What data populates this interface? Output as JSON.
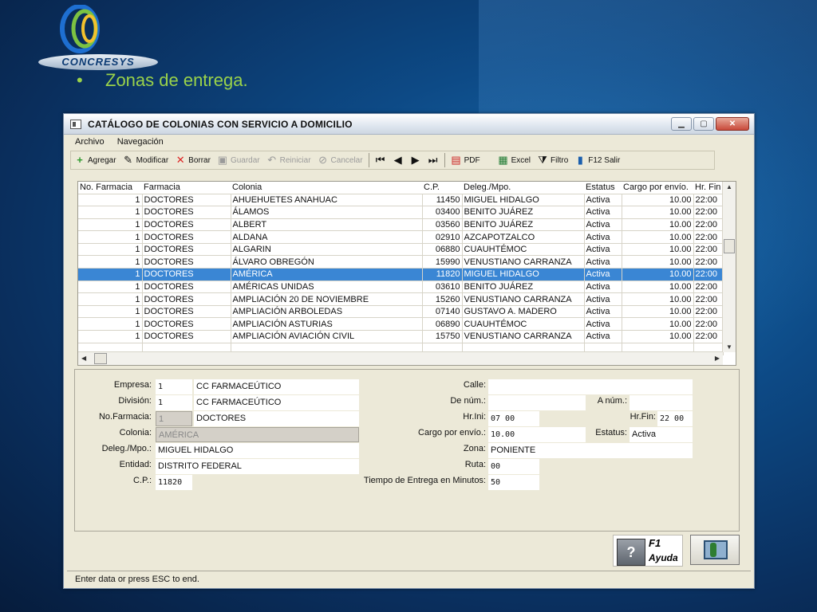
{
  "slide": {
    "logo_text": "CONCRESYS",
    "bullet": "•",
    "title": "Zonas de entrega."
  },
  "window": {
    "title": "CATÁLOGO DE COLONIAS CON SERVICIO A DOMICILIO",
    "controls": {
      "minimize": "▁",
      "maximize": "▢",
      "close": "✕"
    }
  },
  "menu": {
    "archivo": "Archivo",
    "navegacion": "Navegación"
  },
  "toolbar": {
    "agregar": "Agregar",
    "modificar": "Modificar",
    "borrar": "Borrar",
    "guardar": "Guardar",
    "reiniciar": "Reiniciar",
    "cancelar": "Cancelar",
    "pdf": "PDF",
    "excel": "Excel",
    "filtro": "Filtro",
    "salir": "F12  Salir"
  },
  "grid": {
    "columns": [
      "No. Farmacia",
      "Farmacia",
      "Colonia",
      "C.P.",
      "Deleg./Mpo.",
      "Estatus",
      "Cargo por envío.",
      "Hr. Fin"
    ],
    "rows": [
      [
        "1",
        "DOCTORES",
        "AHUEHUETES ANAHUAC",
        "11450",
        "MIGUEL HIDALGO",
        "Activa",
        "10.00",
        "22:00"
      ],
      [
        "1",
        "DOCTORES",
        "ÁLAMOS",
        "03400",
        "BENITO JUÁREZ",
        "Activa",
        "10.00",
        "22:00"
      ],
      [
        "1",
        "DOCTORES",
        "ALBERT",
        "03560",
        "BENITO JUÁREZ",
        "Activa",
        "10.00",
        "22:00"
      ],
      [
        "1",
        "DOCTORES",
        "ALDANA",
        "02910",
        "AZCAPOTZALCO",
        "Activa",
        "10.00",
        "22:00"
      ],
      [
        "1",
        "DOCTORES",
        "ALGARIN",
        "06880",
        "CUAUHTÉMOC",
        "Activa",
        "10.00",
        "22:00"
      ],
      [
        "1",
        "DOCTORES",
        "ÁLVARO OBREGÓN",
        "15990",
        "VENUSTIANO CARRANZA",
        "Activa",
        "10.00",
        "22:00"
      ],
      [
        "1",
        "DOCTORES",
        "AMÉRICA",
        "11820",
        "MIGUEL HIDALGO",
        "Activa",
        "10.00",
        "22:00"
      ],
      [
        "1",
        "DOCTORES",
        "AMÉRICAS UNIDAS",
        "03610",
        "BENITO JUÁREZ",
        "Activa",
        "10.00",
        "22:00"
      ],
      [
        "1",
        "DOCTORES",
        "AMPLIACIÓN 20 DE NOVIEMBRE",
        "15260",
        "VENUSTIANO CARRANZA",
        "Activa",
        "10.00",
        "22:00"
      ],
      [
        "1",
        "DOCTORES",
        "AMPLIACIÓN ARBOLEDAS",
        "07140",
        "GUSTAVO A. MADERO",
        "Activa",
        "10.00",
        "22:00"
      ],
      [
        "1",
        "DOCTORES",
        "AMPLIACIÓN ASTURIAS",
        "06890",
        "CUAUHTÉMOC",
        "Activa",
        "10.00",
        "22:00"
      ],
      [
        "1",
        "DOCTORES",
        "AMPLIACIÓN AVIACIÓN CIVIL",
        "15750",
        "VENUSTIANO CARRANZA",
        "Activa",
        "10.00",
        "22:00"
      ]
    ],
    "selected_row": 6
  },
  "detail": {
    "empresa": {
      "label": "Empresa:",
      "code": "1",
      "name": "CC FARMACEÚTICO"
    },
    "division": {
      "label": "División:",
      "code": "1",
      "name": "CC FARMACEÚTICO"
    },
    "nofarmacia": {
      "label": "No.Farmacia:",
      "code": "1",
      "name": "DOCTORES"
    },
    "colonia": {
      "label": "Colonia:",
      "value": "AMÉRICA"
    },
    "deleg": {
      "label": "Deleg./Mpo.:",
      "value": "MIGUEL HIDALGO"
    },
    "entidad": {
      "label": "Entidad:",
      "value": "DISTRITO FEDERAL"
    },
    "cp": {
      "label": "C.P.:",
      "value": "11820"
    },
    "calle": {
      "label": "Calle:",
      "value": ""
    },
    "de_num": {
      "label": "De núm.:",
      "value": ""
    },
    "a_num": {
      "label": "A núm.:",
      "value": ""
    },
    "hr_ini": {
      "label": "Hr.Ini:",
      "value": "07 00"
    },
    "hr_fin": {
      "label": "Hr.Fin:",
      "value": "22 00"
    },
    "cargo": {
      "label": "Cargo por envío.:",
      "value": "10.00"
    },
    "estatus": {
      "label": "Estatus:",
      "value": "Activa"
    },
    "zona": {
      "label": "Zona:",
      "value": "PONIENTE"
    },
    "ruta": {
      "label": "Ruta:",
      "value": "00"
    },
    "tiempo": {
      "label": "Tiempo de Entrega en Minutos:",
      "value": "50"
    }
  },
  "help": {
    "key": "F1",
    "label": "Ayuda",
    "glyph": "?"
  },
  "status_bar": "Enter data or press ESC to end.",
  "colors": {
    "selection": "#3a86d4",
    "title_green": "#9ad24a"
  }
}
